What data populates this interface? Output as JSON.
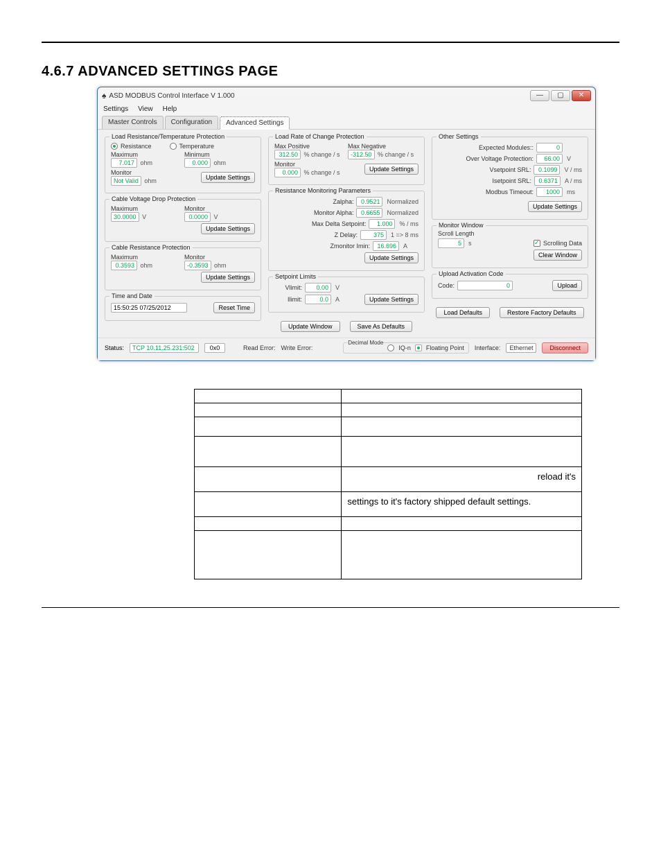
{
  "heading": "4.6.7 ADVANCED SETTINGS PAGE",
  "window": {
    "title": "ASD MODBUS Control Interface V 1.000",
    "menus": [
      "Settings",
      "View",
      "Help"
    ],
    "tabs": [
      "Master Controls",
      "Configuration",
      "Advanced Settings"
    ],
    "min": "—",
    "max": "▢",
    "close": "✕"
  },
  "load_res_temp": {
    "title": "Load Resistance/Temperature Protection",
    "radio_res": "Resistance",
    "radio_temp": "Temperature",
    "maximum_lbl": "Maximum",
    "maximum_val": "7.017",
    "maximum_unit": "ohm",
    "minimum_lbl": "Minimum",
    "minimum_val": "0.000",
    "minimum_unit": "ohm",
    "monitor_lbl": "Monitor",
    "monitor_val": "Not Valid",
    "monitor_unit": "ohm",
    "update": "Update Settings"
  },
  "cable_vdrop": {
    "title": "Cable Voltage Drop Protection",
    "maximum_lbl": "Maximum",
    "maximum_val": "30.0000",
    "maximum_unit": "V",
    "monitor_lbl": "Monitor",
    "monitor_val": "0.0000",
    "monitor_unit": "V",
    "update": "Update Settings"
  },
  "cable_res": {
    "title": "Cable Resistance Protection",
    "maximum_lbl": "Maximum",
    "maximum_val": "0.3593",
    "maximum_unit": "ohm",
    "monitor_lbl": "Monitor",
    "monitor_val": "-0.3593",
    "monitor_unit": "ohm",
    "update": "Update Settings"
  },
  "time_date": {
    "title": "Time and Date",
    "value": "15:50:25 07/25/2012",
    "reset": "Reset Time"
  },
  "load_roc": {
    "title": "Load Rate of Change Protection",
    "max_pos_lbl": "Max Positive",
    "max_pos_val": "312.50",
    "max_pos_unit": "% change / s",
    "max_neg_lbl": "Max Negative",
    "max_neg_val": "-312.50",
    "max_neg_unit": "% change / s",
    "monitor_lbl": "Monitor",
    "monitor_val": "0.000",
    "monitor_unit": "% change / s",
    "update": "Update Settings"
  },
  "res_monitor": {
    "title": "Resistance Monitoring Parameters",
    "zalpha_lbl": "Zalpha:",
    "zalpha_val": "0.9521",
    "zalpha_unit": "Normalized",
    "monalpha_lbl": "Monitor Alpha:",
    "monalpha_val": "0.6655",
    "monalpha_unit": "Normalized",
    "maxdelta_lbl": "Max Delta Setpoint:",
    "maxdelta_val": "1.000",
    "maxdelta_unit": "% / ms",
    "zdelay_lbl": "Z Delay:",
    "zdelay_val": "375",
    "zdelay_unit": "1 => 8 ms",
    "zimin_lbl": "Zmonitor Imin:",
    "zimin_val": "16.696",
    "zimin_unit": "A",
    "update": "Update Settings"
  },
  "setpoint_limits": {
    "title": "Setpoint Limits",
    "vlimit_lbl": "Vlimit:",
    "vlimit_val": "0.00",
    "vlimit_unit": "V",
    "ilimit_lbl": "Ilimit:",
    "ilimit_val": "0.0",
    "ilimit_unit": "A",
    "update": "Update Settings"
  },
  "other": {
    "title": "Other Settings",
    "expected_lbl": "Expected Modules::",
    "expected_val": "0",
    "ovp_lbl": "Over Voltage Protection:",
    "ovp_val": "66.00",
    "ovp_unit": "V",
    "vsrl_lbl": "Vsetpoint SRL:",
    "vsrl_val": "0.1099",
    "vsrl_unit": "V / ms",
    "isrl_lbl": "Isetpoint SRL:",
    "isrl_val": "0.6371",
    "isrl_unit": "A / ms",
    "mbto_lbl": "Modbus Timeout:",
    "mbto_val": "1000",
    "mbto_unit": "ms",
    "update": "Update Settings"
  },
  "monitor_window": {
    "title": "Monitor Window",
    "scroll_lbl": "Scroll Length",
    "scroll_val": "5",
    "scroll_unit": "s",
    "chk_lbl": "Scrolling Data",
    "clear": "Clear Window"
  },
  "upload_code": {
    "title": "Upload Activation Code",
    "code_lbl": "Code:",
    "code_val": "0",
    "upload": "Upload"
  },
  "bottom_btns": {
    "update_window": "Update Window",
    "save_defaults": "Save As Defaults",
    "load_defaults": "Load Defaults",
    "restore_factory": "Restore Factory Defaults"
  },
  "status": {
    "label": "Status:",
    "conn": "TCP 10.11.25.231:502",
    "hex": "0x0",
    "read_lbl": "Read Error:",
    "read_val": "",
    "write_lbl": "Write Error:",
    "write_val": "",
    "decimal_title": "Decimal Mode",
    "iqn": "IQ-n",
    "float": "Floating Point",
    "iface_lbl": "Interface:",
    "iface_val": "Ethernet",
    "disconnect": "Disconnect"
  },
  "info_table_rows": [
    [
      "",
      ""
    ],
    [
      "",
      ""
    ],
    [
      "",
      ""
    ],
    [
      "",
      ""
    ],
    [
      "",
      "reload it's"
    ],
    [
      "",
      "settings to it's factory shipped default settings."
    ],
    [
      "",
      ""
    ],
    [
      "",
      ""
    ]
  ]
}
